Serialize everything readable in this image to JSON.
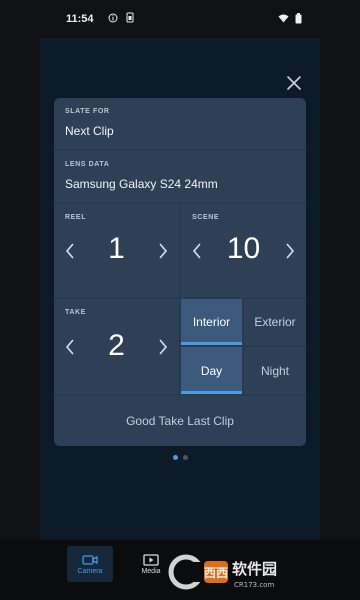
{
  "status_bar": {
    "time": "11:54"
  },
  "slate": {
    "slate_for": {
      "label": "SLATE FOR",
      "value": "Next Clip"
    },
    "lens_data": {
      "label": "LENS DATA",
      "value": "Samsung Galaxy S24 24mm"
    },
    "reel": {
      "label": "REEL",
      "value": "1"
    },
    "scene": {
      "label": "SCENE",
      "value": "10"
    },
    "take": {
      "label": "TAKE",
      "value": "2"
    },
    "location": {
      "options": [
        "Interior",
        "Exterior"
      ],
      "selected": "Interior"
    },
    "time_of_day": {
      "options": [
        "Day",
        "Night"
      ],
      "selected": "Day"
    },
    "good_take_label": "Good Take Last Clip"
  },
  "pager": {
    "page": 1,
    "total": 2
  },
  "bottom_nav": {
    "tabs": [
      {
        "label": "Camera",
        "icon": "camera-icon",
        "active": true
      },
      {
        "label": "Media",
        "icon": "media-icon",
        "active": false
      }
    ]
  },
  "watermark": {
    "text": "软件园",
    "subtext": "CR173.com"
  },
  "colors": {
    "accent": "#4a9be8",
    "active_toggle": "#3d5a7d",
    "card": "#2e4056",
    "panel": "#0d1a28"
  }
}
